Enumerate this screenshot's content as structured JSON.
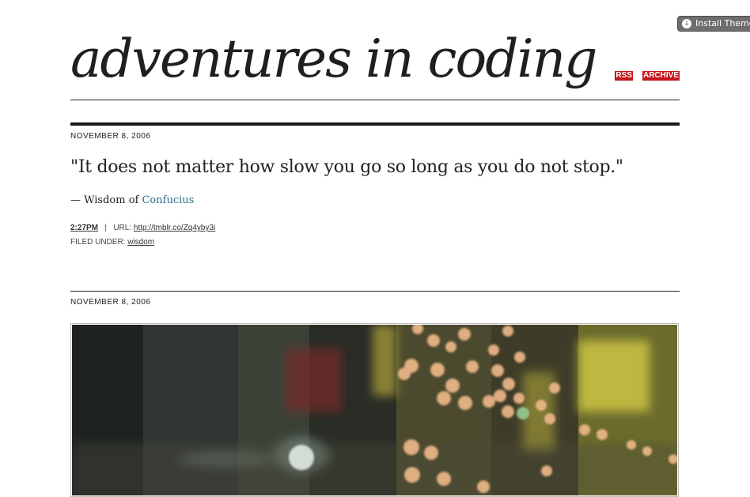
{
  "install_theme": {
    "label": "Install Theme"
  },
  "site": {
    "title": "adventures in coding"
  },
  "nav": {
    "rss": "RSS",
    "archive": "ARCHIVE"
  },
  "posts": [
    {
      "date": "NOVEMBER 8, 2006",
      "quote": "\"It does not matter how slow you go so long as you do not stop.\"",
      "source_prefix": "— Wisdom of ",
      "source_link": "Confucius",
      "time": "2:27PM",
      "separator": "|",
      "url_label": "URL:",
      "url": "http://tmblr.co/Zq4yby3i",
      "filed_label": "FILED UNDER:",
      "tag": "wisdom"
    },
    {
      "date": "NOVEMBER 8, 2006"
    }
  ],
  "colors": {
    "accent": "#c4161c",
    "link": "#2a6d8e"
  }
}
